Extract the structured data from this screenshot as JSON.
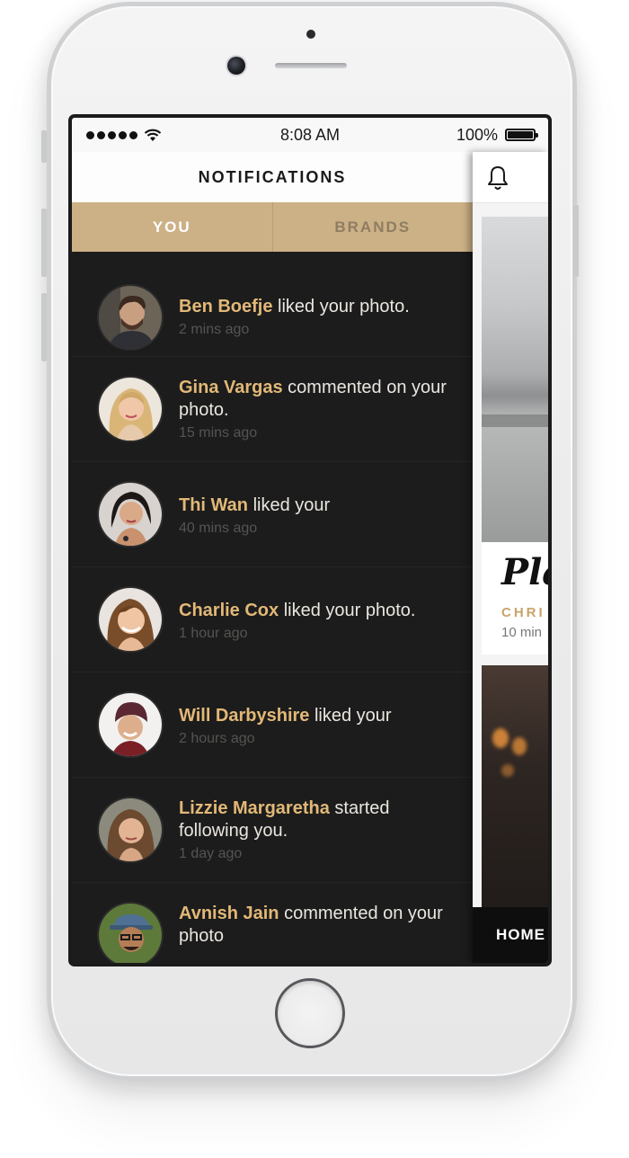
{
  "status_bar": {
    "time": "8:08 AM",
    "battery": "100%",
    "battery_level": 1.0
  },
  "drawer": {
    "title": "NOTIFICATIONS",
    "tabs": [
      {
        "label": "YOU",
        "active": true
      },
      {
        "label": "BRANDS",
        "active": false
      }
    ],
    "notifications": [
      {
        "name": "Ben Boefje",
        "action": " liked your photo.",
        "time": "2 mins ago"
      },
      {
        "name": "Gina Vargas",
        "action": " commented on your photo.",
        "time": "15 mins ago"
      },
      {
        "name": "Thi Wan",
        "action": " liked your",
        "time": "40 mins ago"
      },
      {
        "name": "Charlie Cox",
        "action": " liked your photo.",
        "time": "1 hour ago"
      },
      {
        "name": "Will Darbyshire",
        "action": " liked your",
        "time": "2 hours ago"
      },
      {
        "name": "Lizzie Margaretha",
        "action": " started following you.",
        "time": "1 day ago"
      },
      {
        "name": "Avnish Jain",
        "action": " commented on your photo",
        "time": ""
      }
    ]
  },
  "feed": {
    "card_title": "Pla",
    "card_author": "CHRI",
    "card_time": "10 min",
    "nav_label": "HOME"
  },
  "colors": {
    "accent": "#cdb186",
    "name": "#e2b877",
    "background": "#1c1c1c"
  }
}
